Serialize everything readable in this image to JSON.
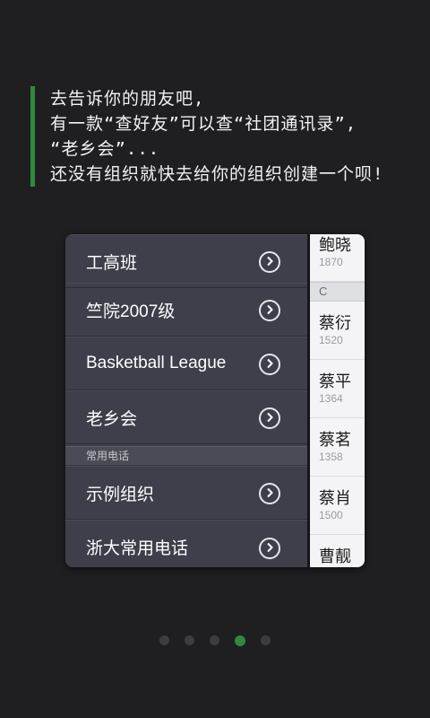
{
  "intro": {
    "lines": [
      "去告诉你的朋友吧,",
      "有一款“查好友”可以查“社团通讯录”,",
      "“老乡会”...",
      "还没有组织就快去给你的组织创建一个呗!"
    ]
  },
  "menu": {
    "items": [
      {
        "label": "工高班"
      },
      {
        "label": "竺院2007级"
      },
      {
        "label": "Basketball League"
      },
      {
        "label": "老乡会"
      }
    ],
    "section_header": "常用电话",
    "section_items": [
      {
        "label": "示例组织"
      },
      {
        "label": "浙大常用电话"
      }
    ]
  },
  "contacts": {
    "top_item": {
      "name": "鲍晓",
      "phone": "1870"
    },
    "letter": "C",
    "items": [
      {
        "name": "蔡衍",
        "phone": "1520"
      },
      {
        "name": "蔡平",
        "phone": "1364"
      },
      {
        "name": "蔡茗",
        "phone": "1358"
      },
      {
        "name": "蔡肖",
        "phone": "1500"
      },
      {
        "name": "曹靓",
        "phone": ""
      }
    ]
  },
  "pager": {
    "count": 5,
    "active_index": 3
  },
  "colors": {
    "accent": "#2f8a3a",
    "background": "#1f1f21",
    "menu": "#3e3f4a"
  }
}
